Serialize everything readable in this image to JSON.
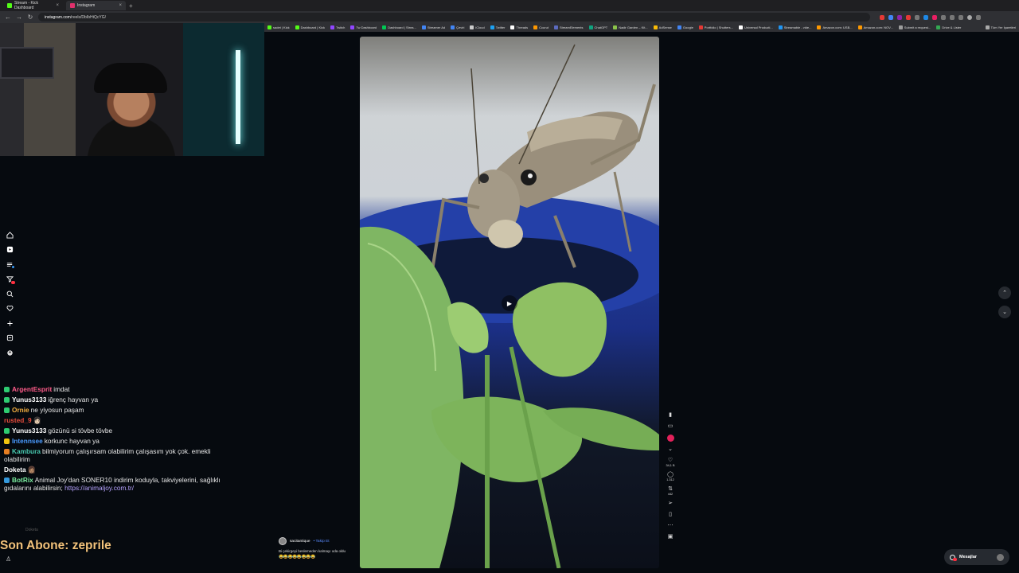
{
  "browser": {
    "tabs": [
      {
        "label": "Stream - Kick Dashboard",
        "favicon_color": "#53fc18"
      },
      {
        "label": "Instagram",
        "favicon_color": "#e1306c"
      }
    ],
    "url_domain": "instagram.com",
    "url_path": "/reels/DbIbHtQcYG/",
    "bookmarks": [
      {
        "label": "sadet | Kick",
        "color": "#53fc18"
      },
      {
        "label": "Dashboard | Kick",
        "color": "#53fc18"
      },
      {
        "label": "Twitch",
        "color": "#9146ff"
      },
      {
        "label": "Tw Dashboard",
        "color": "#9146ff"
      },
      {
        "label": "Dashboard | Strea...",
        "color": "#00c853"
      },
      {
        "label": "Streamer Ad",
        "color": "#4285f4"
      },
      {
        "label": "Çeviri",
        "color": "#4285f4"
      },
      {
        "label": "iCloud",
        "color": "#cccccc"
      },
      {
        "label": "Twitter",
        "color": "#1da1f2"
      },
      {
        "label": "Threads",
        "color": "#ffffff"
      },
      {
        "label": "Ccurut",
        "color": "#ff9800"
      },
      {
        "label": "StreamElements",
        "color": "#5c6bc0"
      },
      {
        "label": "ChatGPT",
        "color": "#10a37f"
      },
      {
        "label": "Nadir Garden – Kit...",
        "color": "#8bc34a"
      },
      {
        "label": "AdSense",
        "color": "#fbbc05"
      },
      {
        "label": "Google",
        "color": "#4285f4"
      },
      {
        "label": "Portfolio | Shutters...",
        "color": "#e53935"
      },
      {
        "label": "Universal Producti...",
        "color": "#ffffff"
      },
      {
        "label": "Streamable - vide...",
        "color": "#2196f3"
      },
      {
        "label": "Amazon.com: USB...",
        "color": "#ff9900"
      },
      {
        "label": "Amazon.com: NOV...",
        "color": "#ff9900"
      },
      {
        "label": "Submit a request...",
        "color": "#9e9e9e"
      },
      {
        "label": "Drive & Lister",
        "color": "#34a853"
      }
    ],
    "bookmarks_all": "Tüm Yer İşaretleri"
  },
  "chat": [
    {
      "user": "ArgentEsprit",
      "color": "#ff5c8a",
      "text": "imdat",
      "badge": "#2ecc71"
    },
    {
      "user": "Yunus3133",
      "color": "#ffffff",
      "text": "iğrenç hayvan ya",
      "badge": "#2ecc71"
    },
    {
      "user": "Ornie",
      "color": "#f5b041",
      "text": "ne yiyosun paşam",
      "badge": "#2ecc71"
    },
    {
      "user": "rusted_9",
      "color": "#e74c3c",
      "text": "👩🏻",
      "badge": ""
    },
    {
      "user": "Yunus3133",
      "color": "#ffffff",
      "text": "gözünü si tövbe tövbe",
      "badge": "#2ecc71"
    },
    {
      "user": "Intennsee",
      "color": "#4a9bff",
      "text": "korkunc hayvan ya",
      "badge": "#f1c40f"
    },
    {
      "user": "Kambura",
      "color": "#48c9b0",
      "text": "bilmiyorum çalışırsam olabilirim çalışasım yok çok. emekli olabilirim",
      "badge": "#e67e22"
    },
    {
      "user": "Doketa",
      "color": "#ffffff",
      "text": "👩🏽",
      "badge": ""
    },
    {
      "user": "BotRix",
      "color": "#7bed9f",
      "text": "Animal Joy'dan SONER10 indirim koduyla, takviyelerini, sağlıklı gıdalarını alabilirsin;",
      "link": "https://animaljoy.com.tr/",
      "badge": "#3498db"
    }
  ],
  "faded_chat": "Doketa",
  "subscriber": "Son Abone: zeprile",
  "reel": {
    "author": "sacitantique",
    "follow": "• Takip Et",
    "caption": "Bi çekirgeyi beslemeden kalmayı oda oldu",
    "emojis": "😂😂😂😂😂😂😂😂",
    "likes": "34,1 B",
    "comments": "1.312",
    "reposts": "442"
  },
  "messages_label": "Mesajlar",
  "icons": {
    "sidebar": [
      "home-icon",
      "reels-icon",
      "explore-icon",
      "notifications-icon",
      "search-icon",
      "heart-icon",
      "create-icon",
      "messages-icon",
      "profile-icon"
    ]
  }
}
